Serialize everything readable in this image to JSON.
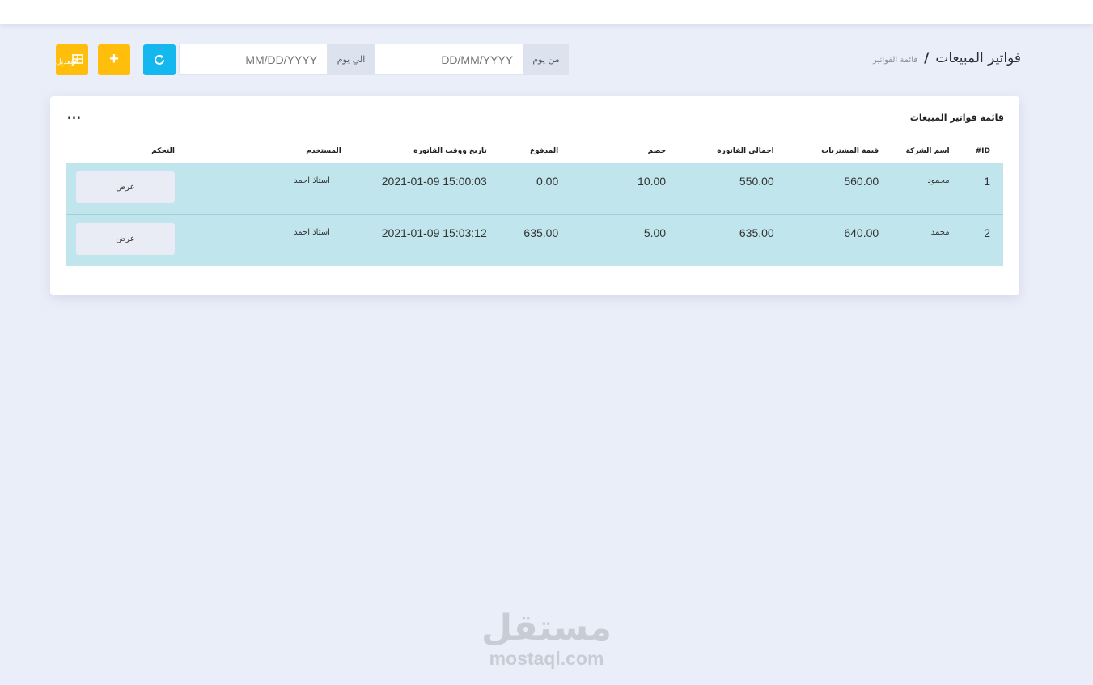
{
  "header": {
    "title": "فواتير المبيعات",
    "separator": "/",
    "breadcrumb": "قائمة الفواتير"
  },
  "filters": {
    "from_label": "من يوم",
    "from_placeholder": "DD/MM/YYYY",
    "to_label": "الي يوم",
    "to_placeholder": "MM/DD/YYYY",
    "edit_label": "تعديل",
    "add_label": "+",
    "refresh_icon": "refresh-icon"
  },
  "card": {
    "title": "قائمة فواتير المبيعات",
    "more": "..."
  },
  "table": {
    "columns": [
      "ID#",
      "اسم الشركة",
      "قيمة المشتريات",
      "اجمالي الفاتورة",
      "خصم",
      "المدفوع",
      "تاريخ ووقت الفاتورة",
      "المستخدم",
      "التحكم"
    ],
    "rows": [
      {
        "id": "1",
        "company": "محمود",
        "purchases": "560.00",
        "total": "550.00",
        "discount": "10.00",
        "paid": "0.00",
        "datetime": "2021-01-09 15:00:03",
        "user": "استاذ احمد",
        "action": "عرض"
      },
      {
        "id": "2",
        "company": "محمد",
        "purchases": "640.00",
        "total": "635.00",
        "discount": "5.00",
        "paid": "635.00",
        "datetime": "2021-01-09 15:03:12",
        "user": "استاذ احمد",
        "action": "عرض"
      }
    ]
  },
  "watermark": {
    "arabic": "مستقل",
    "latin": "mostaql.com"
  },
  "colors": {
    "accent_yellow": "#ffbe0b",
    "accent_blue": "#14b8ef",
    "row_bg": "#c0e5ec",
    "page_bg": "#eaeef9"
  }
}
